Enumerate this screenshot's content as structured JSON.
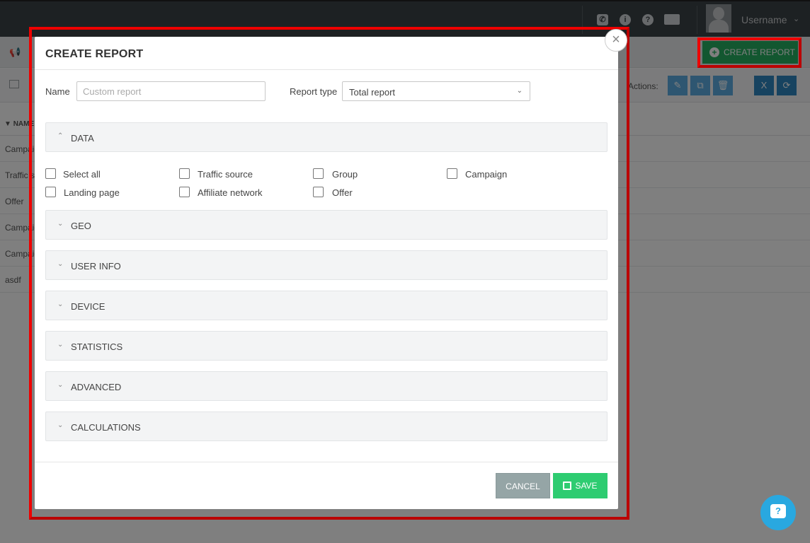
{
  "header": {
    "username": "Username",
    "icons": [
      "phone-icon",
      "info-icon",
      "question-icon",
      "newspaper-icon"
    ]
  },
  "page": {
    "create_report_label": "CREATE REPORT",
    "actions_label": "Actions:",
    "column_name_header": "NAME",
    "rows": [
      "Campaign",
      "Traffic source",
      "Offer",
      "Campaign",
      "Campaign",
      "asdf"
    ]
  },
  "modal": {
    "title": "CREATE REPORT",
    "name_label": "Name",
    "name_placeholder": "Custom report",
    "report_type_label": "Report type",
    "report_type_value": "Total report",
    "sections": {
      "data": "DATA",
      "geo": "GEO",
      "user_info": "USER INFO",
      "device": "DEVICE",
      "statistics": "STATISTICS",
      "advanced": "ADVANCED",
      "calculations": "CALCULATIONS"
    },
    "data_options": {
      "select_all": "Select all",
      "traffic_source": "Traffic source",
      "group": "Group",
      "campaign": "Campaign",
      "landing_page": "Landing page",
      "affiliate_network": "Affiliate network",
      "offer": "Offer"
    },
    "cancel_label": "CANCEL",
    "save_label": "SAVE"
  },
  "colors": {
    "accent_green": "#27ae60",
    "save_green": "#2ecc71",
    "cancel_gray": "#95a5a6",
    "highlight_red": "#e00000",
    "help_blue": "#29a8e0"
  }
}
